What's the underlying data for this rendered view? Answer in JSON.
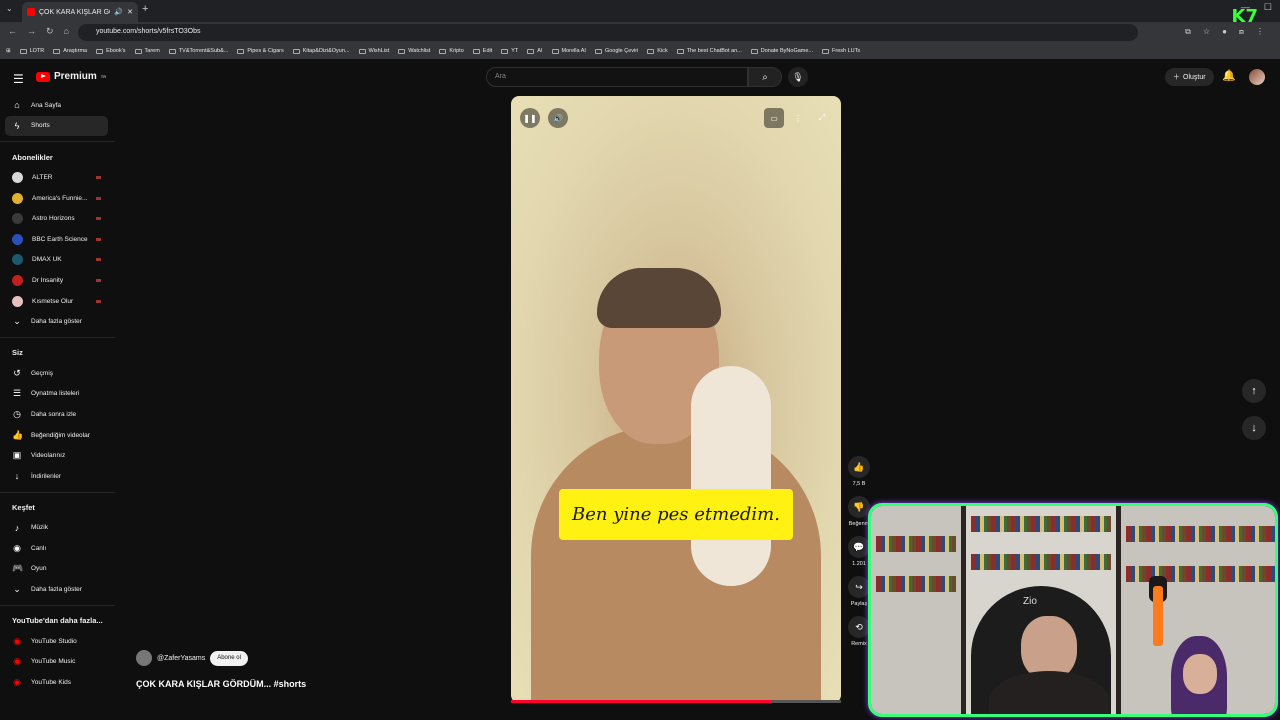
{
  "browser": {
    "tab_title": "ÇOK KARA KIŞLAR GÖRDÜM",
    "url": "youtube.com/shorts/v5frsTO3Obs",
    "bookmarks": [
      "LOTR",
      "Araştırma",
      "Ebook's",
      "Tarem",
      "TV&Torrent&Sub&...",
      "Pipes & Cigars",
      "Kitap&Dizi&Oyun...",
      "WishList",
      "Watchlist",
      "Kripto",
      "Edit",
      "YT",
      "AI",
      "Morella AI",
      "Google Çeviri",
      "Kick",
      "The best ChatBot an...",
      "Donate ByNoGame...",
      "Fresh LUTs"
    ]
  },
  "header": {
    "brand": "Premium",
    "brand_sup": "TR",
    "search_placeholder": "Ara",
    "create_label": "Oluştur"
  },
  "sidebar": {
    "main": [
      {
        "label": "Ana Sayfa",
        "icon": "home-icon"
      },
      {
        "label": "Shorts",
        "icon": "shorts-icon"
      }
    ],
    "subs_title": "Abonelikler",
    "subscriptions": [
      {
        "label": "ALTER",
        "color": "#d8d8d8"
      },
      {
        "label": "America's Funnie...",
        "color": "#e0b030"
      },
      {
        "label": "Astro Horizons",
        "color": "#3a3a3a"
      },
      {
        "label": "BBC Earth Science",
        "color": "#2a50c0"
      },
      {
        "label": "DMAX UK",
        "color": "#1a5a6a"
      },
      {
        "label": "Dr Insanity",
        "color": "#c02020"
      },
      {
        "label": "Kısmetse Olur",
        "color": "#e8c0c0"
      }
    ],
    "subs_more": "Daha fazla göster",
    "you_title": "Siz",
    "you": [
      {
        "label": "Geçmiş",
        "icon": "history-icon"
      },
      {
        "label": "Oynatma listeleri",
        "icon": "playlist-icon"
      },
      {
        "label": "Daha sonra izle",
        "icon": "watch-later-icon"
      },
      {
        "label": "Beğendiğim videolar",
        "icon": "like-icon"
      },
      {
        "label": "Videolarınız",
        "icon": "your-videos-icon"
      },
      {
        "label": "İndirilenler",
        "icon": "download-icon"
      }
    ],
    "explore_title": "Keşfet",
    "explore": [
      {
        "label": "Müzik",
        "icon": "music-icon"
      },
      {
        "label": "Canlı",
        "icon": "live-icon"
      },
      {
        "label": "Oyun",
        "icon": "gaming-icon"
      }
    ],
    "explore_more": "Daha fazla göster",
    "more_title": "YouTube'dan daha fazla...",
    "more": [
      {
        "label": "YouTube Studio"
      },
      {
        "label": "YouTube Music"
      },
      {
        "label": "YouTube Kids"
      }
    ]
  },
  "short": {
    "caption": "Ben yine pes etmedim.",
    "channel": "@ZaferYasams",
    "subscribe": "Abone ol",
    "title": "ÇOK KARA KIŞLAR GÖRDÜM... #shorts",
    "progress": 0.79
  },
  "actions": {
    "likes": "7,5 B",
    "dislike": "Beğenm",
    "comments": "1.201",
    "share": "Paylaş",
    "remix": "Remix"
  },
  "overlay": {
    "logo": "K7",
    "cap_text": "Zio"
  }
}
